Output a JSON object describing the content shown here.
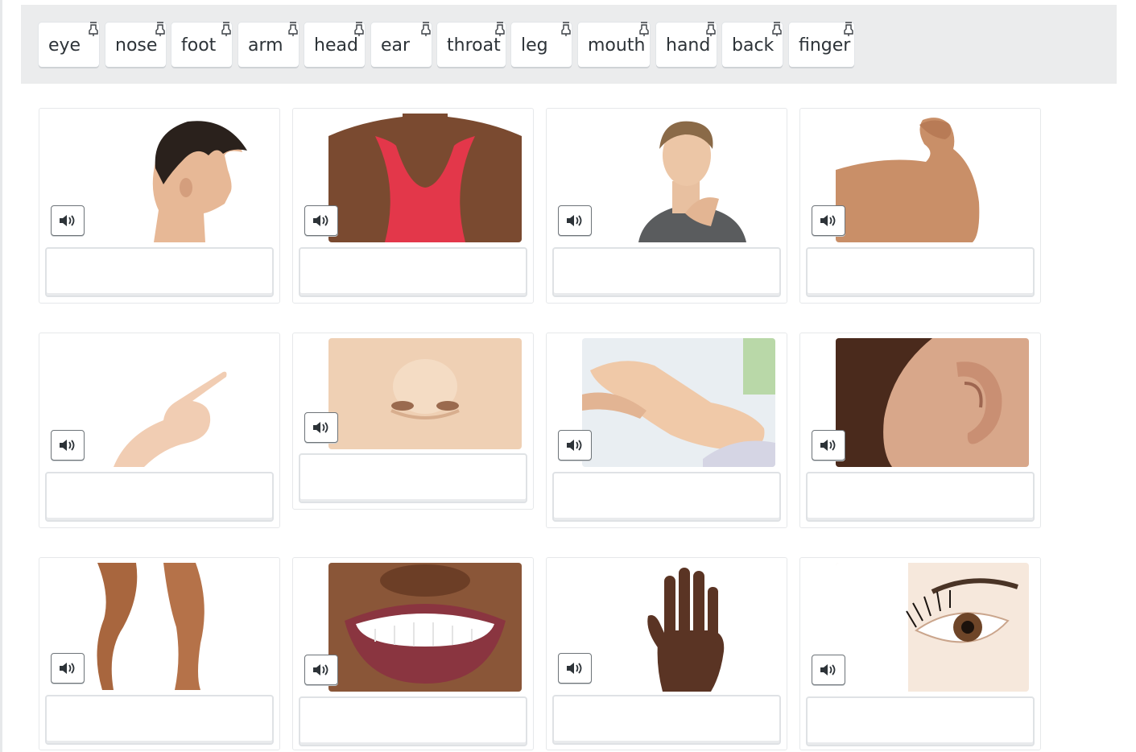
{
  "word_bank": {
    "words": [
      {
        "label": "eye"
      },
      {
        "label": "nose"
      },
      {
        "label": "foot"
      },
      {
        "label": "arm"
      },
      {
        "label": "head"
      },
      {
        "label": "ear"
      },
      {
        "label": "throat"
      },
      {
        "label": "leg"
      },
      {
        "label": "mouth"
      },
      {
        "label": "hand"
      },
      {
        "label": "back"
      },
      {
        "label": "finger"
      }
    ],
    "chip_icon": "hand-pointer-down-icon"
  },
  "cards": [
    {
      "image": "head-side-profile-photo"
    },
    {
      "image": "back-shoulders-photo"
    },
    {
      "image": "man-holding-throat-photo"
    },
    {
      "image": "flexed-arm-photo"
    },
    {
      "image": "pointing-finger-photo"
    },
    {
      "image": "nose-closeup-photo"
    },
    {
      "image": "foot-massage-photo"
    },
    {
      "image": "ear-closeup-photo"
    },
    {
      "image": "legs-photo"
    },
    {
      "image": "smiling-mouth-photo"
    },
    {
      "image": "open-hand-photo"
    },
    {
      "image": "eye-lashes-photo"
    }
  ],
  "audio_icon": "speaker-volume-icon",
  "colors": {
    "bank_bg": "#ebeced",
    "border": "#e6e8ea",
    "text": "#2d3338"
  }
}
